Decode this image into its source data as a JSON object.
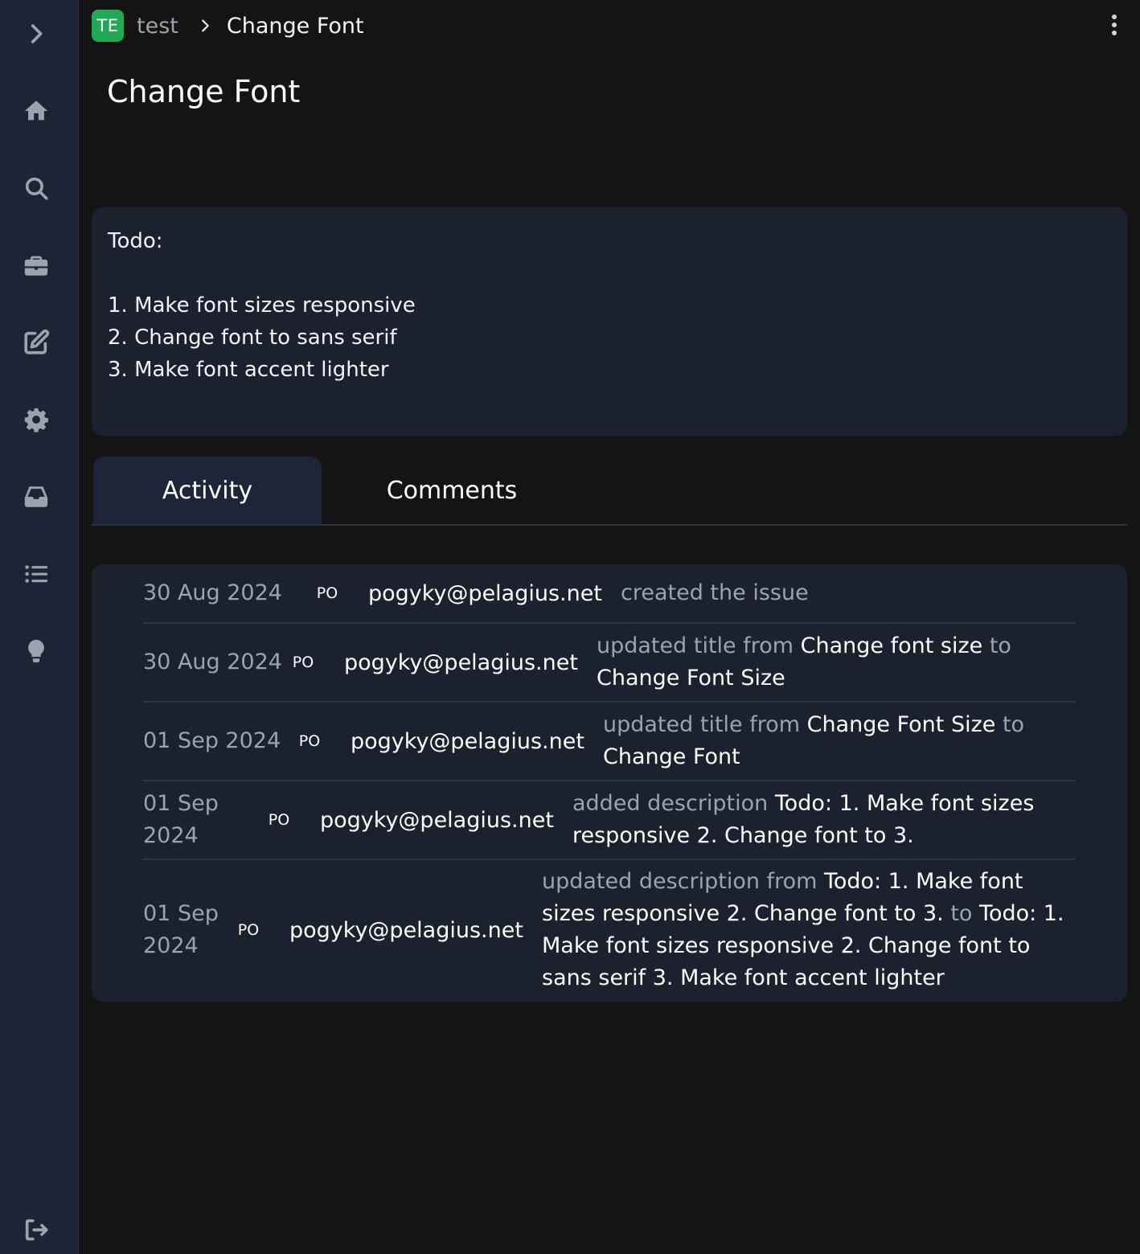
{
  "sidebar": {
    "items": [
      {
        "name": "expand-sidebar-icon"
      },
      {
        "name": "home-icon"
      },
      {
        "name": "search-icon"
      },
      {
        "name": "briefcase-icon"
      },
      {
        "name": "edit-icon"
      },
      {
        "name": "settings-gear-icon"
      },
      {
        "name": "inbox-icon"
      },
      {
        "name": "list-icon"
      },
      {
        "name": "lightbulb-icon"
      },
      {
        "name": "logout-icon"
      }
    ]
  },
  "header": {
    "badge": "TE",
    "badge_color": "#1faa54",
    "project": "test",
    "current": "Change Font"
  },
  "title": "Change Font",
  "description": {
    "lines": [
      "Todo:",
      "",
      "1. Make font sizes responsive",
      "2. Change font to sans serif",
      "3. Make font accent lighter"
    ]
  },
  "tabs": [
    {
      "label": "Activity",
      "active": true
    },
    {
      "label": "Comments",
      "active": false
    }
  ],
  "activity": [
    {
      "date": "30 Aug 2024",
      "avatar": "PO",
      "user": "pogyky@pelagius.net",
      "segments": [
        {
          "text": "created the issue",
          "muted": true
        }
      ]
    },
    {
      "date": "30 Aug 2024",
      "avatar": "PO",
      "user": "pogyky@pelagius.net",
      "segments": [
        {
          "text": "updated title from ",
          "muted": true
        },
        {
          "text": "Change font size",
          "muted": false
        },
        {
          "text": " to ",
          "muted": true
        },
        {
          "text": "Change Font Size",
          "muted": false
        }
      ]
    },
    {
      "date": "01 Sep 2024",
      "avatar": "PO",
      "user": "pogyky@pelagius.net",
      "segments": [
        {
          "text": "updated title from ",
          "muted": true
        },
        {
          "text": "Change Font Size",
          "muted": false
        },
        {
          "text": " to ",
          "muted": true
        },
        {
          "text": "Change Font",
          "muted": false
        }
      ]
    },
    {
      "date": "01 Sep 2024",
      "avatar": "PO",
      "user": "pogyky@pelagius.net",
      "segments": [
        {
          "text": "added description ",
          "muted": true
        },
        {
          "text": "Todo: 1. Make font sizes responsive 2. Change font to 3.",
          "muted": false
        }
      ]
    },
    {
      "date": "01 Sep 2024",
      "avatar": "PO",
      "user": "pogyky@pelagius.net",
      "segments": [
        {
          "text": "updated description from ",
          "muted": true
        },
        {
          "text": "Todo: 1. Make font sizes responsive 2. Change font to 3.",
          "muted": false
        },
        {
          "text": " to ",
          "muted": true
        },
        {
          "text": "Todo: 1. Make font sizes responsive 2. Change font to sans serif 3. Make font accent lighter",
          "muted": false
        }
      ]
    }
  ]
}
